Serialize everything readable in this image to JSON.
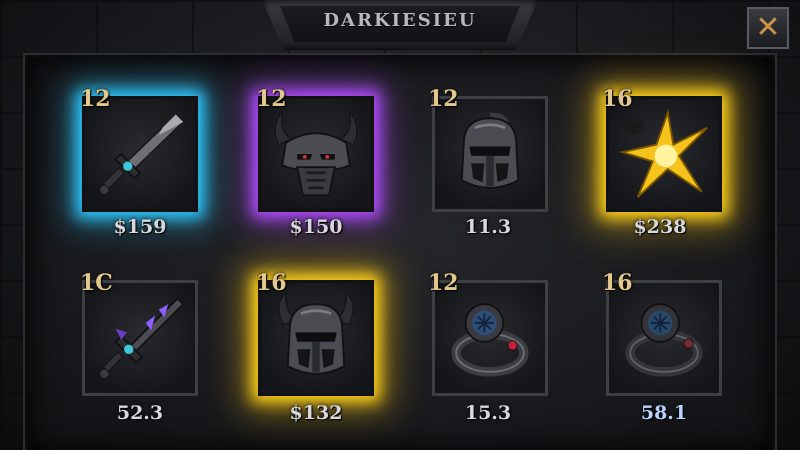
{
  "header": {
    "title": "DARKIESIEU"
  },
  "close_icon": "close-icon",
  "colors": {
    "accent": "#c8934a",
    "blue_glow": "#2fc8ff",
    "purple_glow": "#b04dff",
    "gold_glow": "#ffd21a",
    "price_text": "#d8d8dc",
    "price_blue": "#b9d3ff"
  },
  "items": [
    {
      "level": "12",
      "price": "$159",
      "icon": "sword-icon",
      "rarity": "blue"
    },
    {
      "level": "12",
      "price": "$150",
      "icon": "horned-armor-icon",
      "rarity": "purple"
    },
    {
      "level": "12",
      "price": "11.3",
      "icon": "helmet-icon",
      "rarity": "none"
    },
    {
      "level": "16",
      "price": "$238",
      "icon": "star-burst-icon",
      "rarity": "gold"
    },
    {
      "level": "1C",
      "price": "52.3",
      "icon": "spiked-sword-icon",
      "rarity": "none"
    },
    {
      "level": "16",
      "price": "$132",
      "icon": "horned-helmet-icon",
      "rarity": "gold"
    },
    {
      "level": "12",
      "price": "15.3",
      "icon": "ruby-ring-icon",
      "rarity": "none"
    },
    {
      "level": "16",
      "price": "58.1",
      "icon": "dark-ring-icon",
      "rarity": "none"
    }
  ]
}
